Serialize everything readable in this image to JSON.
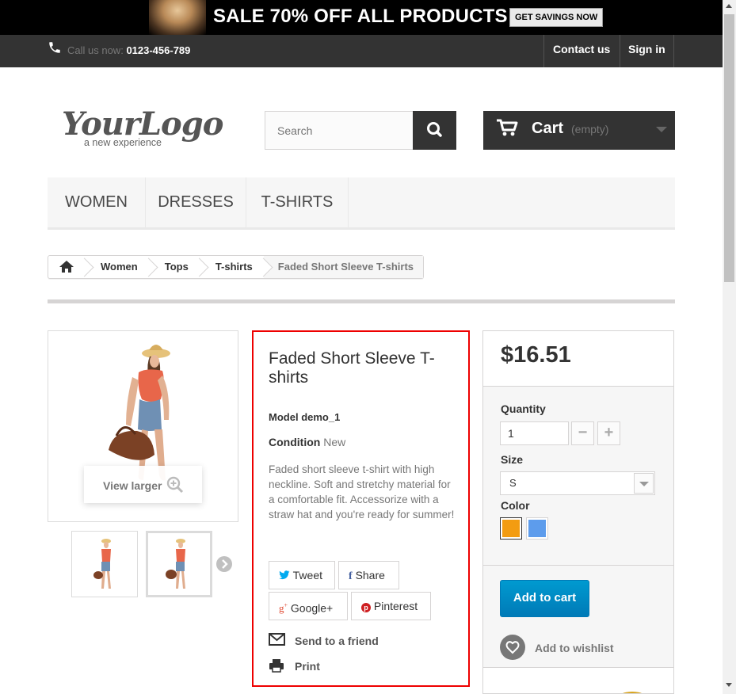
{
  "promo": {
    "text": "SALE 70% OFF ALL PRODUCTS",
    "button_label": "GET SAVINGS NOW"
  },
  "topnav": {
    "call_label": "Call us now:",
    "phone": "0123-456-789",
    "contact_label": "Contact us",
    "signin_label": "Sign in"
  },
  "logo": {
    "main": "YourLogo",
    "tagline": "a new experience"
  },
  "search": {
    "placeholder": "Search"
  },
  "cart": {
    "label": "Cart",
    "status": "(empty)"
  },
  "menu": {
    "items": [
      "WOMEN",
      "DRESSES",
      "T-SHIRTS"
    ]
  },
  "breadcrumb": {
    "items": [
      "Women",
      "Tops",
      "T-shirts"
    ],
    "current": "Faded Short Sleeve T-shirts"
  },
  "gallery": {
    "view_larger": "View larger"
  },
  "product": {
    "title": "Faded Short Sleeve T-shirts",
    "model_label": "Model",
    "model_value": "demo_1",
    "condition_label": "Condition",
    "condition_value": "New",
    "description": "Faded short sleeve t-shirt with high neckline. Soft and stretchy material for a comfortable fit. Accessorize with a straw hat and you're ready for summer!",
    "social": {
      "tweet": "Tweet",
      "share": "Share",
      "google": "Google+",
      "pinterest": "Pinterest"
    },
    "send_to_friend": "Send to a friend",
    "print": "Print"
  },
  "buy": {
    "price": "$16.51",
    "quantity_label": "Quantity",
    "quantity_value": "1",
    "size_label": "Size",
    "size_value": "S",
    "color_label": "Color",
    "colors": [
      "#f39c11",
      "#5d9cec"
    ],
    "add_to_cart": "Add to cart",
    "wishlist": "Add to wishlist"
  }
}
